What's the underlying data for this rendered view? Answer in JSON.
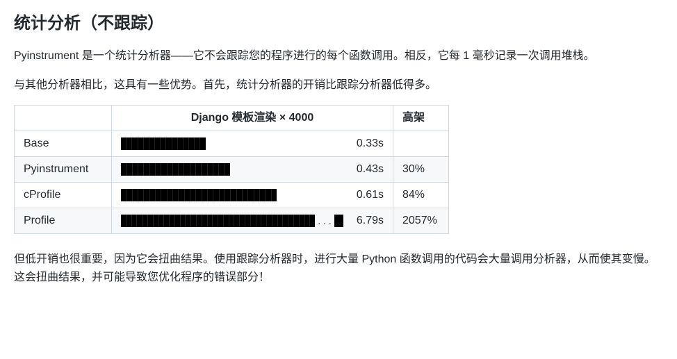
{
  "heading": "统计分析（不跟踪）",
  "para1": "Pyinstrument 是一个统计分析器——它不会跟踪您的程序进行的每个函数调用。相反，它每 1 毫秒记录一次调用堆栈。",
  "para2": "与其他分析器相比，这具有一些优势。首先，统计分析器的开销比跟踪分析器低得多。",
  "table": {
    "col1_header": "",
    "col2_header": "Django 模板渲染 × 4000",
    "col3_header": "高架",
    "rows": [
      {
        "name": "Base",
        "time": "0.33s",
        "overhead": "",
        "bar_pct": 38,
        "segs": 15,
        "truncated": false
      },
      {
        "name": "Pyinstrument",
        "time": "0.43s",
        "overhead": "30%",
        "bar_pct": 49,
        "segs": 19,
        "truncated": false
      },
      {
        "name": "cProfile",
        "time": "0.61s",
        "overhead": "84%",
        "bar_pct": 70,
        "segs": 27,
        "truncated": false
      },
      {
        "name": "Profile",
        "time": "6.79s",
        "overhead": "2057%",
        "bar_pct": 92,
        "segs": 36,
        "truncated": true
      }
    ]
  },
  "para3": "但低开销也很重要，因为它会扭曲结果。使用跟踪分析器时，进行大量 Python 函数调用的代码会大量调用分析器，从而使其变慢。这会扭曲结果，并可能导致您优化程序的错误部分！",
  "ellipsis": ". . ."
}
